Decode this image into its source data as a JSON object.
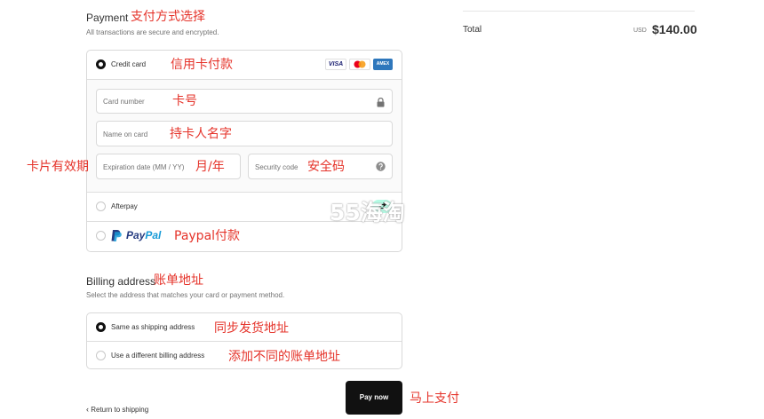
{
  "payment": {
    "title": "Payment",
    "subtitle": "All transactions are secure and encrypted.",
    "methods": {
      "credit_card": "Credit card",
      "afterpay": "Afterpay",
      "paypal_pay": "Pay",
      "paypal_pal": "Pal"
    },
    "card_brands": [
      "VISA",
      "AMEX"
    ],
    "fields": {
      "card_number": "Card number",
      "name_on_card": "Name on card",
      "expiration": "Expiration date (MM / YY)",
      "security_code": "Security code"
    }
  },
  "billing": {
    "title": "Billing address",
    "subtitle": "Select the address that matches your card or payment method.",
    "options": {
      "same": "Same as shipping address",
      "different": "Use a different billing address"
    }
  },
  "actions": {
    "return": "Return to shipping",
    "pay_now": "Pay now"
  },
  "summary": {
    "total_label": "Total",
    "currency": "USD",
    "total_value": "$140.00"
  },
  "annotations": {
    "payment_method": "支付方式选择",
    "credit_card": "信用卡付款",
    "card_number": "卡号",
    "cardholder_name": "持卡人名字",
    "card_expiry": "卡片有效期",
    "month_year": "月/年",
    "security_code": "安全码",
    "paypal": "Paypal付款",
    "billing_address": "账单地址",
    "same_address": "同步发货地址",
    "different_address": "添加不同的账单地址",
    "pay_now": "马上支付"
  },
  "watermark": "55海淘",
  "colors": {
    "accent": "#111111",
    "annotation": "#e5332a",
    "paypal_dark": "#253b80",
    "paypal_light": "#179bd7",
    "visa": "#1a1f71",
    "amex": "#2e77bc"
  }
}
